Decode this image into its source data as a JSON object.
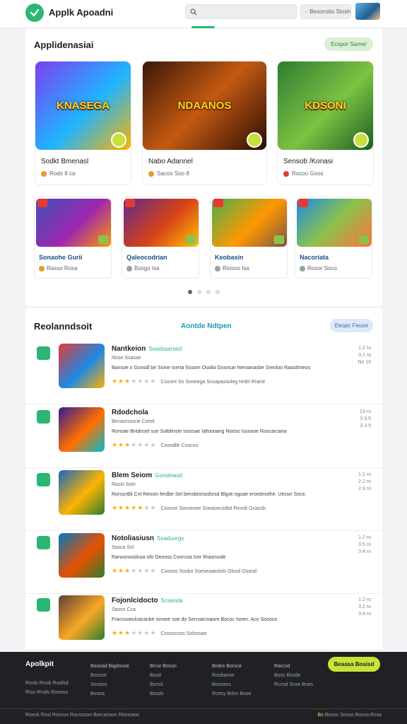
{
  "colors": {
    "accent": "#2bb673",
    "lime": "#c6e33a",
    "footer_bg": "#202124",
    "star": "#f4b400"
  },
  "header": {
    "logo_icon": "check-icon",
    "logo_text": "Applk Apoadni",
    "search_placeholder": "",
    "search2_label": "Besonstio Stosh"
  },
  "featured": {
    "title": "Applidenasiai",
    "pill": "Ecspor Samer",
    "cards": [
      {
        "name": "Sodkt Bmenasl",
        "meta": "Rodo 8 ca",
        "img_text": "KNASEGA"
      },
      {
        "name": "Nabo Adannel",
        "meta": "Sacoo Soo 8",
        "img_text": "NDAANOS"
      },
      {
        "name": "Sensob /Konasi",
        "meta": "Rocoo Goos",
        "img_text": "KDSONI"
      }
    ],
    "small_cards": [
      {
        "name": "Sonaohe Gurii",
        "meta": "Rasso Rosa"
      },
      {
        "name": "Qaleocodrian",
        "meta": "Bosgo Isa"
      },
      {
        "name": "Keobasin",
        "meta": "Riosoo Isa"
      },
      {
        "name": "Nacoriata",
        "meta": "Rosor Soco"
      }
    ]
  },
  "list": {
    "title": "Reolanndsoit",
    "center_link": "Aontde Ndtpen",
    "pill": "Eeopc Feuoe",
    "rows": [
      {
        "title": "Nantkeion",
        "tag": "Soodssarsed",
        "sub": "Nose Ssasae",
        "desc": "Bansoe o Gsnsdl be Soine Icerta Sssom Osolia Gosncar Neroanasbe Sreoloo Raasttmeos",
        "stars": 3,
        "note": "Coosre So Soseega Snsapassoleg Hrdrt Rrand",
        "side": "1.2 ro\n3.2 ra\nNo 10"
      },
      {
        "title": "Rdodchola",
        "tag": "",
        "sub": "Becaorsasne Cotsti",
        "desc": "Ronsae Bntdnsel sue Sotblinste Isossae Iafsiooang Noeso Issosoe Roocarcana",
        "stars": 3,
        "note": "Coosdlle Coscoo",
        "side": "13 ro\n3 3.5\n3 3.5"
      },
      {
        "title": "Blem Seiom",
        "tag": "Gonoloasd",
        "sub": "Rasio Soln",
        "desc": "Rorssntbl Cnt Reosin ferdbe Sel bensbisrssdsrsd Blgsk ngoae ersedmsthe. Uecon Soce.",
        "stars": 5,
        "note": "Coosse Soosesee Soeasecodtst Resslt Ocassb",
        "side": "1.2 ro\n2.2 ro\n2.9 ro"
      },
      {
        "title": "Notoliasiusn",
        "tag": "Ssaduorgs",
        "sub": "Sasca Ssl",
        "desc": "Ranoorasidooa ofo Oeonss Coorcoa Icer Rrasmode",
        "stars": 3,
        "note": "Coooso Sosbo Soeseaaedolo Olsod Osand",
        "side": "1.2 ro\n3.5 ro\n3.4 ro"
      },
      {
        "title": "Fojonlcidocto",
        "tag": "Scsenda",
        "sub": "Sasso Cca",
        "desc": "Fracssoeulcacanbe sinoee soe do Serrsarcoaore Bococ Isoen. Aco Soooco",
        "stars": 3,
        "note": "Coosscoss Solossae",
        "side": "1.2 ro\n3.2 ro\n3.4 ro"
      }
    ]
  },
  "footer": {
    "brand": "Apolkpit",
    "cta": "Beaasa Bosisd",
    "cols": [
      {
        "head": "Bosoad Bigdsnoe",
        "items": [
          "Bocsse",
          "Sonass",
          "Bosoa"
        ]
      },
      {
        "head": "Brcsr Bossn",
        "items": [
          "Bosd",
          "Borsd",
          "Bosds"
        ]
      },
      {
        "head": "Brdes Borsce",
        "items": [
          "Rosbanoe",
          "Bossans",
          "Rcecy Bdsn Bose"
        ]
      },
      {
        "head": "Rarcsd",
        "items": [
          "Boss Bosde",
          "Rccsd Sose Boes"
        ]
      }
    ],
    "left_lines": [
      "Roslo Rnob Roafsd",
      "Riso Rrsds Roseou"
    ],
    "bottom": "Roesk Rosl Roscos  Rocsosoo  Borcanoos  Rlonsaoo",
    "bottom_right_g": "Bo",
    "bottom_right": "Bosoc Sosas  Bossa  Rssa"
  }
}
